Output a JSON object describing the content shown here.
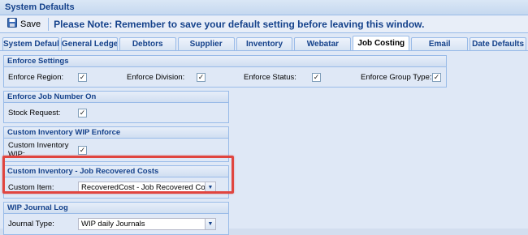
{
  "window": {
    "title": "System Defaults"
  },
  "toolbar": {
    "save_label": "Save",
    "notice": "Please Note: Remember to save your default setting before leaving this window."
  },
  "tabs": [
    {
      "label": "System Defaults",
      "active": false
    },
    {
      "label": "General Ledger",
      "active": false
    },
    {
      "label": "Debtors",
      "active": false
    },
    {
      "label": "Supplier",
      "active": false
    },
    {
      "label": "Inventory",
      "active": false
    },
    {
      "label": "Webatar",
      "active": false
    },
    {
      "label": "Job Costing",
      "active": true
    },
    {
      "label": "Email",
      "active": false
    },
    {
      "label": "Date Defaults",
      "active": false
    }
  ],
  "enforce_settings": {
    "title": "Enforce Settings",
    "region": {
      "label": "Enforce Region:",
      "checked": true
    },
    "division": {
      "label": "Enforce Division:",
      "checked": true
    },
    "status": {
      "label": "Enforce Status:",
      "checked": true
    },
    "group_type": {
      "label": "Enforce Group Type:",
      "checked": true
    }
  },
  "enforce_job_number": {
    "title": "Enforce Job Number On",
    "stock_request": {
      "label": "Stock Request:",
      "checked": true
    }
  },
  "custom_inventory_wip": {
    "title": "Custom Inventory WIP Enforce",
    "field": {
      "label_line1": "Custom Inventory",
      "label_line2": "WIP:",
      "checked": true
    }
  },
  "recovered_costs": {
    "title": "Custom Inventory - Job Recovered Costs",
    "custom_item": {
      "label": "Custom Item:",
      "value": "RecoveredCost - Job Recovered Costs"
    }
  },
  "wip_journal_log": {
    "title": "WIP Journal Log",
    "journal_type": {
      "label": "Journal Type:",
      "value": "WIP daily Journals"
    }
  },
  "icons": {
    "checked_glyph": "✓",
    "dropdown_glyph": "▼"
  },
  "colors": {
    "header_text": "#15428b",
    "highlight": "#e0453f",
    "border": "#99bbe8"
  }
}
